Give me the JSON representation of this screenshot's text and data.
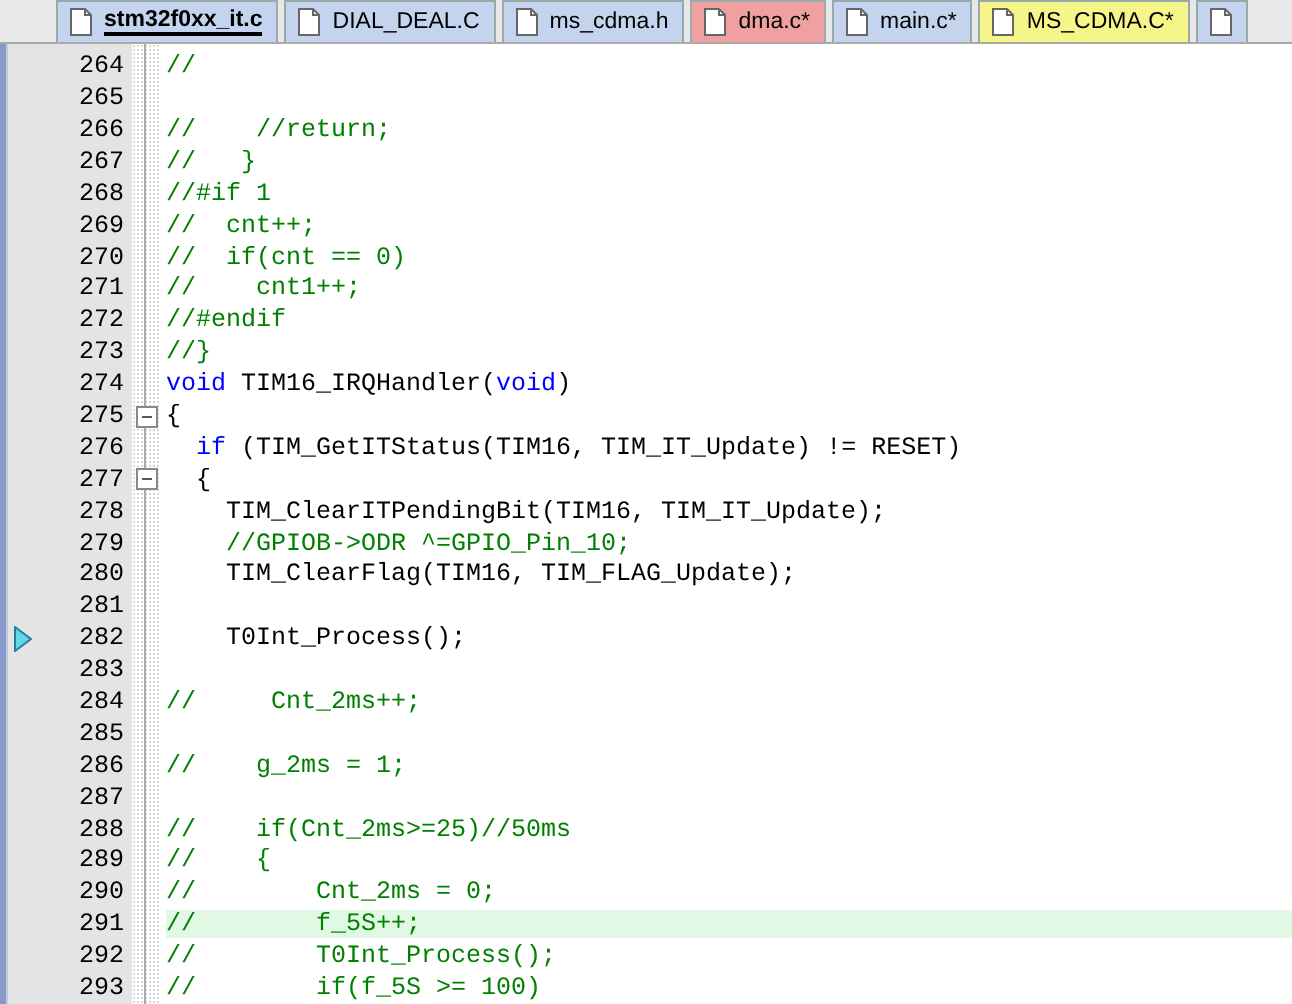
{
  "tabs": [
    {
      "label": "stm32f0xx_it.c",
      "selected": true,
      "color": "#c5d4ee"
    },
    {
      "label": "DIAL_DEAL.C",
      "selected": false,
      "color": "#c5d4ee"
    },
    {
      "label": "ms_cdma.h",
      "selected": false,
      "color": "#c5d4ee"
    },
    {
      "label": "dma.c*",
      "selected": false,
      "color": "#f0a0a0"
    },
    {
      "label": "main.c*",
      "selected": false,
      "color": "#c5d4ee"
    },
    {
      "label": "MS_CDMA.C*",
      "selected": false,
      "color": "#f5f58a"
    },
    {
      "selected": false,
      "color": "#c5d4ee"
    }
  ],
  "lines": [
    {
      "number": "264",
      "segments": [
        {
          "kind": "comment",
          "text": "//"
        }
      ]
    },
    {
      "number": "265"
    },
    {
      "number": "266",
      "segments": [
        {
          "kind": "comment",
          "text": "//    //return;"
        }
      ]
    },
    {
      "number": "267",
      "segments": [
        {
          "kind": "comment",
          "text": "//   }"
        }
      ]
    },
    {
      "number": "268",
      "segments": [
        {
          "kind": "comment",
          "text": "//#if 1"
        }
      ]
    },
    {
      "number": "269",
      "segments": [
        {
          "kind": "comment",
          "text": "//  cnt++;"
        }
      ]
    },
    {
      "number": "270",
      "segments": [
        {
          "kind": "comment",
          "text": "//  if(cnt == 0)"
        }
      ]
    },
    {
      "number": "271",
      "segments": [
        {
          "kind": "comment",
          "text": "//    cnt1++;"
        }
      ]
    },
    {
      "number": "272",
      "segments": [
        {
          "kind": "comment",
          "text": "//#endif"
        }
      ]
    },
    {
      "number": "273",
      "segments": [
        {
          "kind": "comment",
          "text": "//}"
        }
      ]
    },
    {
      "number": "274",
      "segments": [
        {
          "kind": "keyword",
          "text": "void"
        },
        {
          "kind": "plain",
          "text": " TIM16_IRQHandler("
        },
        {
          "kind": "keyword",
          "text": "void"
        },
        {
          "kind": "plain",
          "text": ")"
        }
      ]
    },
    {
      "number": "275",
      "fold": true,
      "segments": [
        {
          "kind": "plain",
          "text": "{"
        }
      ]
    },
    {
      "number": "276",
      "segments": [
        {
          "kind": "keyword",
          "text": "  if"
        },
        {
          "kind": "plain",
          "text": " (TIM_GetITStatus(TIM16, TIM_IT_Update) != RESET)"
        }
      ]
    },
    {
      "number": "277",
      "fold": true,
      "segments": [
        {
          "kind": "plain",
          "text": "  {"
        }
      ]
    },
    {
      "number": "278",
      "segments": [
        {
          "kind": "plain",
          "text": "    TIM_ClearITPendingBit(TIM16, TIM_IT_Update);"
        }
      ]
    },
    {
      "number": "279",
      "segments": [
        {
          "kind": "comment",
          "text": "    //GPIOB->ODR ^=GPIO_Pin_10;"
        }
      ]
    },
    {
      "number": "280",
      "segments": [
        {
          "kind": "plain",
          "text": "    TIM_ClearFlag(TIM16, TIM_FLAG_Update);"
        }
      ]
    },
    {
      "number": "281"
    },
    {
      "number": "282",
      "bookmark": true,
      "segments": [
        {
          "kind": "plain",
          "text": "    T0Int_Process();"
        }
      ]
    },
    {
      "number": "283"
    },
    {
      "number": "284",
      "segments": [
        {
          "kind": "comment",
          "text": "//     Cnt_2ms++;"
        }
      ]
    },
    {
      "number": "285"
    },
    {
      "number": "286",
      "segments": [
        {
          "kind": "comment",
          "text": "//    g_2ms = 1;"
        }
      ]
    },
    {
      "number": "287"
    },
    {
      "number": "288",
      "segments": [
        {
          "kind": "comment",
          "text": "//    if(Cnt_2ms>=25)//50ms"
        }
      ]
    },
    {
      "number": "289",
      "segments": [
        {
          "kind": "comment",
          "text": "//    {"
        }
      ]
    },
    {
      "number": "290",
      "segments": [
        {
          "kind": "comment",
          "text": "//        Cnt_2ms = 0;"
        }
      ]
    },
    {
      "number": "291",
      "highlighted": true,
      "segments": [
        {
          "kind": "comment",
          "text": "//        f_5S++;"
        }
      ]
    },
    {
      "number": "292",
      "segments": [
        {
          "kind": "comment",
          "text": "//        T0Int_Process();"
        }
      ]
    },
    {
      "number": "293",
      "segments": [
        {
          "kind": "comment",
          "text": "//        if(f_5S >= 100)"
        }
      ]
    }
  ]
}
